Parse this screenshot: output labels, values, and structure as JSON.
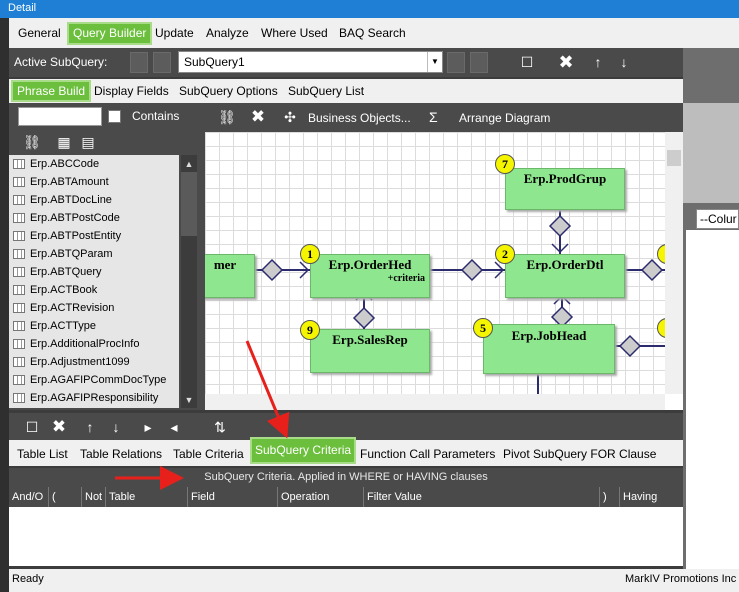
{
  "window": {
    "title": "Detail"
  },
  "main_tabs": [
    "General",
    "Query Builder",
    "Update",
    "Analyze",
    "Where Used",
    "BAQ Search"
  ],
  "subquery": {
    "label": "Active SubQuery:",
    "value": "SubQuery1"
  },
  "sub_tabs": [
    "Phrase Build",
    "Display Fields",
    "SubQuery Options",
    "SubQuery List"
  ],
  "search": {
    "value": "",
    "contains_label": "Contains"
  },
  "tables": [
    "Erp.ABCCode",
    "Erp.ABTAmount",
    "Erp.ABTDocLine",
    "Erp.ABTPostCode",
    "Erp.ABTPostEntity",
    "Erp.ABTQParam",
    "Erp.ABTQuery",
    "Erp.ACTBook",
    "Erp.ACTRevision",
    "Erp.ACTType",
    "Erp.AdditionalProcInfo",
    "Erp.Adjustment1099",
    "Erp.AGAFIPCommDocType",
    "Erp.AGAFIPResponsibility"
  ],
  "designer_toolbar": {
    "business_objects": "Business Objects...",
    "sigma": "Σ",
    "arrange": "Arrange Diagram"
  },
  "diagram": {
    "nodes": [
      {
        "id": "7",
        "name": "Erp.ProdGrup",
        "sub": ""
      },
      {
        "id": "",
        "name": "mer",
        "sub": ""
      },
      {
        "id": "1",
        "name": "Erp.OrderHed",
        "sub": "+criteria"
      },
      {
        "id": "2",
        "name": "Erp.OrderDtl",
        "sub": ""
      },
      {
        "id": "9",
        "name": "Erp.SalesRep",
        "sub": ""
      },
      {
        "id": "5",
        "name": "Erp.JobHead",
        "sub": ""
      }
    ]
  },
  "bottom_tabs": [
    "Table List",
    "Table Relations",
    "Table Criteria",
    "SubQuery Criteria",
    "Function Call Parameters",
    "Pivot SubQuery FOR Clause"
  ],
  "criteria_info": "SubQuery Criteria. Applied in WHERE or HAVING clauses",
  "grid_columns": [
    "And/O",
    "(",
    "Not",
    "Table",
    "Field",
    "Operation",
    "Filter Value",
    ")",
    "Having"
  ],
  "right_combo": "--Colur",
  "status": {
    "left": "Ready",
    "right": "MarkIV Promotions Inc"
  },
  "colors": {
    "accent_green": "#6bbf3c",
    "node_green": "#8ee68e",
    "arrow_red": "#e8201c",
    "badge_yellow": "#f5f500"
  }
}
